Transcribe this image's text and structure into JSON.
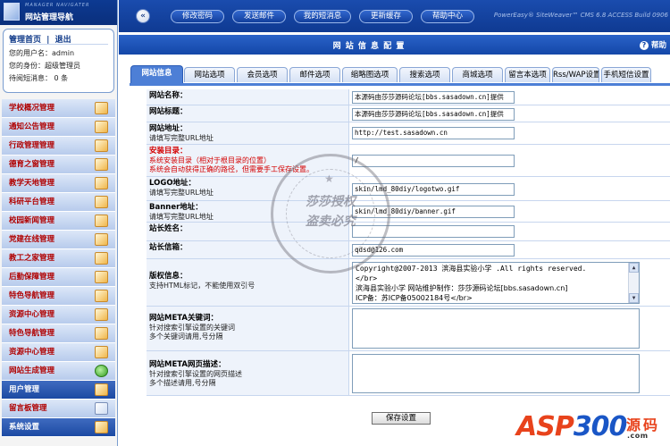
{
  "sidebar": {
    "logo_sub": "MANAGER NAVIGATER",
    "logo_title": "网站管理导航",
    "nav_links": {
      "home": "管理首页",
      "separator": "|",
      "logout": "退出"
    },
    "user_info": [
      "您的用户名：admin",
      "您的身份：超级管理员",
      "待阅短消息： 0 条"
    ],
    "menu": [
      {
        "label": "学校概况管理",
        "style": "red",
        "icon": "edit-icon"
      },
      {
        "label": "通知公告管理",
        "style": "red",
        "icon": "edit-icon"
      },
      {
        "label": "行政管理管理",
        "style": "red",
        "icon": "edit-icon"
      },
      {
        "label": "德育之窗管理",
        "style": "red",
        "icon": "edit-icon"
      },
      {
        "label": "教学天地管理",
        "style": "red",
        "icon": "edit-icon"
      },
      {
        "label": "科研平台管理",
        "style": "red",
        "icon": "edit-icon"
      },
      {
        "label": "校园新闻管理",
        "style": "red",
        "icon": "edit-icon"
      },
      {
        "label": "党建在线管理",
        "style": "red",
        "icon": "edit-icon"
      },
      {
        "label": "教工之家管理",
        "style": "red",
        "icon": "edit-icon"
      },
      {
        "label": "后勤保障管理",
        "style": "red",
        "icon": "edit-icon"
      },
      {
        "label": "特色导航管理",
        "style": "red",
        "icon": "edit-icon"
      },
      {
        "label": "资源中心管理",
        "style": "red",
        "icon": "edit-icon"
      },
      {
        "label": "特色导航管理",
        "style": "red",
        "icon": "edit-icon"
      },
      {
        "label": "资源中心管理",
        "style": "red",
        "icon": "edit-icon"
      },
      {
        "label": "网站生成管理",
        "style": "red",
        "icon": "globe-icon"
      },
      {
        "label": "用户管理",
        "style": "dark",
        "icon": "edit-icon"
      },
      {
        "label": "留言板管理",
        "style": "red",
        "icon": "pencil-icon"
      },
      {
        "label": "系统设置",
        "style": "dark",
        "icon": "edit-icon"
      }
    ]
  },
  "topbar": {
    "buttons": [
      "修改密码",
      "发送邮件",
      "我的短消息",
      "更新缓存",
      "帮助中心"
    ],
    "powered_by": "PowerEasy® SiteWeaver™ CMS 6.8 ACCESS Build 0906"
  },
  "title_bar": {
    "title": "网 站 信 息 配 置",
    "help": "帮助"
  },
  "tabs": [
    "网站信息",
    "网站选项",
    "会员选项",
    "邮件选项",
    "缩略图选项",
    "搜索选项",
    "商城选项",
    "留言本选项",
    "Rss/WAP设置",
    "手机短信设置"
  ],
  "form": [
    {
      "label": "网站名称：",
      "desc": [],
      "value": "本源码由莎莎源码论坛[bbs.sasadown.cn]提供",
      "type": "input"
    },
    {
      "label": "网站标题：",
      "desc": [],
      "value": "本源码由莎莎源码论坛[bbs.sasadown.cn]提供",
      "type": "input"
    },
    {
      "label": "网站地址：",
      "desc": [
        "请填写完整URL地址"
      ],
      "value": "http://test.sasadown.cn",
      "type": "input"
    },
    {
      "label": "安装目录：",
      "desc": [
        "系统安装目录（相对于根目录的位置）",
        "系统会自动获得正确的路径，但需要手工保存设置。"
      ],
      "value": "/",
      "type": "input",
      "red": true
    },
    {
      "label": "LOGO地址：",
      "desc": [
        "请填写完整URL地址"
      ],
      "value": "skin/lmd_80diy/logotwo.gif",
      "type": "input"
    },
    {
      "label": "Banner地址：",
      "desc": [
        "请填写完整URL地址"
      ],
      "value": "skin/lmd_80diy/banner.gif",
      "type": "input"
    },
    {
      "label": "站长姓名：",
      "desc": [],
      "value": "",
      "type": "input"
    },
    {
      "label": "站长信箱：",
      "desc": [],
      "value": "qdsd@126.com",
      "type": "input"
    },
    {
      "label": "版权信息：",
      "desc": [
        "支持HTML标记，不能使用双引号"
      ],
      "value_lines": [
        "Copyright@2007-2013 滨海县实验小学 .All rights reserved.",
        "</br>",
        "滨海县实验小学 网站维护制作：莎莎源码论坛[bbs.sasadown.cn]",
        "ICP备：苏ICP备05002184号</br>"
      ],
      "type": "textarea"
    },
    {
      "label": "网站META关键词：",
      "desc": [
        "针对搜索引擎设置的关键词",
        "多个关键词请用,号分隔"
      ],
      "value_lines": [],
      "type": "textarea"
    },
    {
      "label": "网站META网页描述：",
      "desc": [
        "针对搜索引擎设置的网页描述",
        "多个描述请用,号分隔"
      ],
      "value_lines": [],
      "type": "textarea"
    }
  ],
  "save_button": "保存设置",
  "watermark": {
    "line1": "莎莎授权",
    "line2": "盗卖必究"
  },
  "asp300": {
    "asp": "ASP",
    "num": "300",
    "yuan": "源",
    "ma": "码",
    "domain": ".com"
  }
}
